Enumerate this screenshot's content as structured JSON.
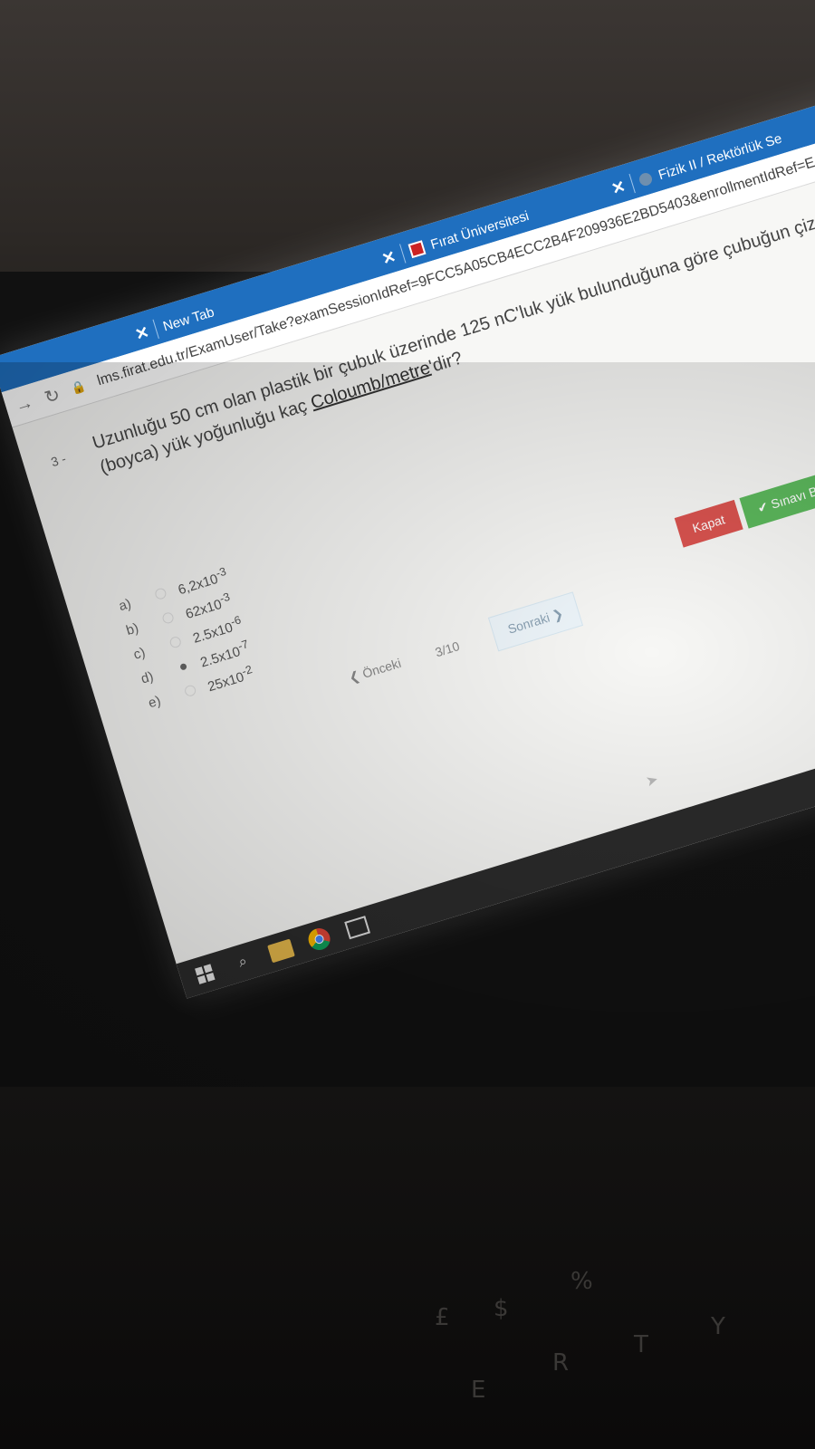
{
  "browser": {
    "tabs": [
      {
        "label": "New Tab"
      },
      {
        "label": "Fırat Üniversitesi"
      },
      {
        "label": "Fizik II / Rektörlük Se"
      }
    ],
    "url": "lms.firat.edu.tr/ExamUser/Take?examSessionIdRef=9FCC5A05CB4ECC2B4F209936E2BD5403&enrollmentIdRef=E"
  },
  "question": {
    "number": "3 -",
    "text_before": "Uzunluğu 50 cm olan plastik bir çubuk üzerinde 125 nC'luk yük bulunduğuna göre çubuğun çizgisel (boyca) yük yoğunluğu kaç ",
    "text_underlined": "Coloumb/metre",
    "text_after": "'dir?"
  },
  "options": [
    {
      "label": "a)",
      "mantissa": "6,2x10",
      "exp": "-3",
      "selected": false
    },
    {
      "label": "b)",
      "mantissa": "62x10",
      "exp": "-3",
      "selected": false
    },
    {
      "label": "c)",
      "mantissa": "2.5x10",
      "exp": "-6",
      "selected": false
    },
    {
      "label": "d)",
      "mantissa": "2.5x10",
      "exp": "-7",
      "selected": true
    },
    {
      "label": "e)",
      "mantissa": "25x10",
      "exp": "-2",
      "selected": false
    }
  ],
  "pager": {
    "prev": "Önceki",
    "counter": "3/10",
    "next": "Sonraki"
  },
  "actions": {
    "close": "Kapat",
    "finish": "Sınavı Bitir"
  }
}
